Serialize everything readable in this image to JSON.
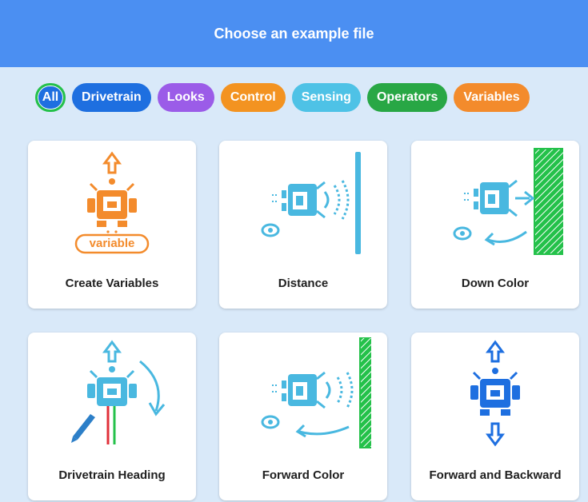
{
  "header": {
    "title": "Choose an example file"
  },
  "filters": [
    {
      "label": "All",
      "color": "#1e6fe0"
    },
    {
      "label": "Drivetrain",
      "color": "#1e6fe0"
    },
    {
      "label": "Looks",
      "color": "#9b5ce8"
    },
    {
      "label": "Control",
      "color": "#f39321"
    },
    {
      "label": "Sensing",
      "color": "#4ec2e6"
    },
    {
      "label": "Operators",
      "color": "#28a745"
    },
    {
      "label": "Variables",
      "color": "#f38b2c"
    }
  ],
  "cards": [
    {
      "label": "Create Variables",
      "icon": "variable-robot-icon",
      "badge": "variable"
    },
    {
      "label": "Distance",
      "icon": "distance-sensor-icon"
    },
    {
      "label": "Down Color",
      "icon": "down-color-sensor-icon"
    },
    {
      "label": "Drivetrain Heading",
      "icon": "heading-robot-icon"
    },
    {
      "label": "Forward Color",
      "icon": "forward-color-sensor-icon"
    },
    {
      "label": "Forward and Backward",
      "icon": "forward-backward-robot-icon"
    }
  ],
  "colors": {
    "header": "#4b8ff2",
    "panel": "#d9e9f9",
    "sensing": "#49b8e0",
    "variables": "#f38b2c",
    "drivetrain": "#1e6fe0",
    "green": "#24c14a"
  }
}
